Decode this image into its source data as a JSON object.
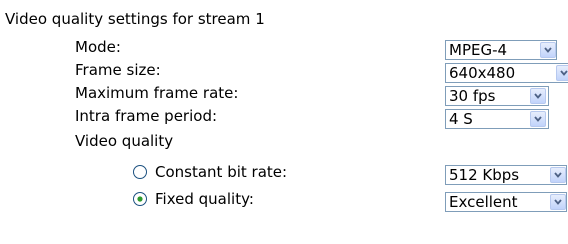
{
  "section": {
    "title": "Video quality settings for stream 1"
  },
  "fields": {
    "mode": {
      "label": "Mode:",
      "value": "MPEG-4"
    },
    "frame_size": {
      "label": "Frame size:",
      "value": "640x480"
    },
    "max_frame_rate": {
      "label": "Maximum frame rate:",
      "value": "30 fps"
    },
    "intra_frame_period": {
      "label": "Intra frame period:",
      "value": "4 S"
    }
  },
  "video_quality": {
    "label": "Video quality",
    "constant_bit_rate": {
      "label": "Constant bit rate:",
      "value": "512 Kbps",
      "selected": false
    },
    "fixed_quality": {
      "label": "Fixed quality:",
      "value": "Excellent",
      "selected": true
    }
  },
  "icons": {
    "dropdown": "chevron-down-icon",
    "radio": "radio-button"
  },
  "colors": {
    "select_border": "#7f9db9",
    "arrow_glyph": "#4d6185",
    "radio_border": "#1c5180"
  }
}
